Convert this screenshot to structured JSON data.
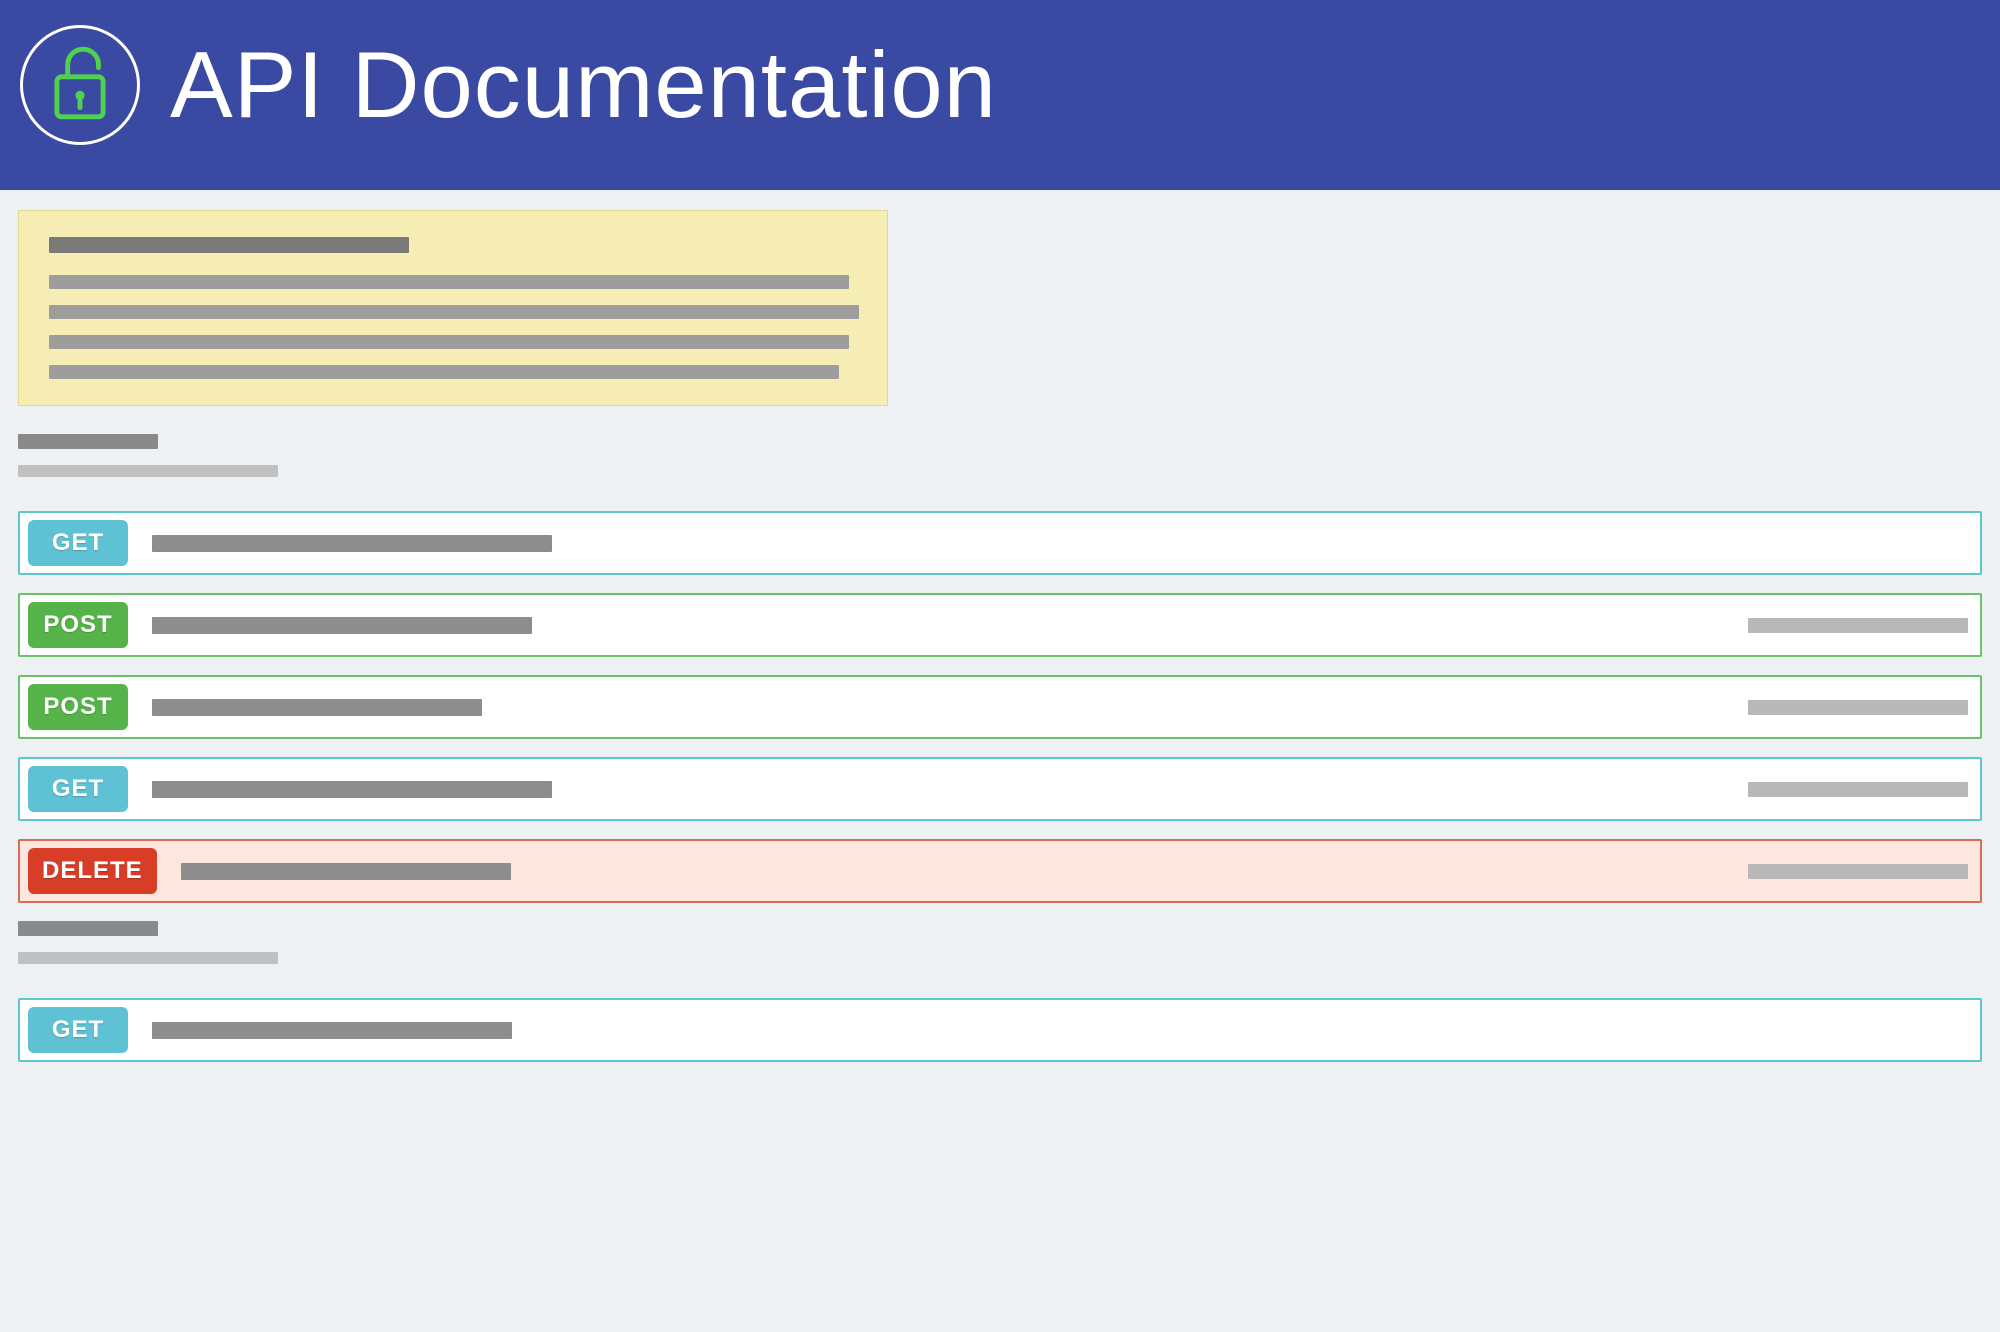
{
  "header": {
    "title": "API Documentation"
  },
  "methods": {
    "get": "GET",
    "post": "POST",
    "delete": "DELETE"
  },
  "colors": {
    "header_bg": "#3a4aa2",
    "get_border": "#5ec7ce",
    "get_badge": "#5fc2d4",
    "post_border": "#6bc26b",
    "post_badge": "#55b34a",
    "delete_border": "#d96b5a",
    "delete_badge": "#d83d28",
    "delete_bg": "#fde6de",
    "info_bg": "#f6edb5"
  },
  "endpoints": [
    {
      "method": "get",
      "path_width": 400,
      "show_summary": false
    },
    {
      "method": "post",
      "path_width": 380,
      "show_summary": true
    },
    {
      "method": "post",
      "path_width": 330,
      "show_summary": true
    },
    {
      "method": "get",
      "path_width": 400,
      "show_summary": true
    },
    {
      "method": "delete",
      "path_width": 330,
      "show_summary": true
    }
  ],
  "second_section_endpoints": [
    {
      "method": "get",
      "path_width": 360,
      "show_summary": false
    }
  ]
}
